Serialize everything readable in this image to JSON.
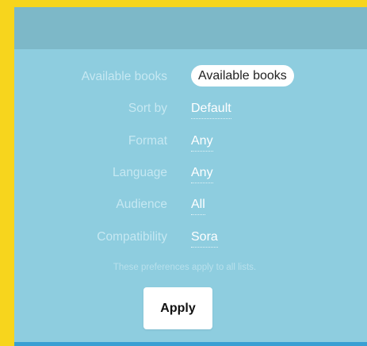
{
  "preferences": {
    "available": {
      "label": "Available books",
      "value": "Available books"
    },
    "sort": {
      "label": "Sort by",
      "value": "Default"
    },
    "format": {
      "label": "Format",
      "value": "Any"
    },
    "language": {
      "label": "Language",
      "value": "Any"
    },
    "audience": {
      "label": "Audience",
      "value": "All"
    },
    "compatibility": {
      "label": "Compatibility",
      "value": "Sora"
    }
  },
  "note": "These preferences apply to all lists.",
  "apply_label": "Apply",
  "colors": {
    "frame": "#f7d51d",
    "panel": "#8ecddf",
    "header": "#7db8c8",
    "footer_bar": "#3a9fd3"
  }
}
